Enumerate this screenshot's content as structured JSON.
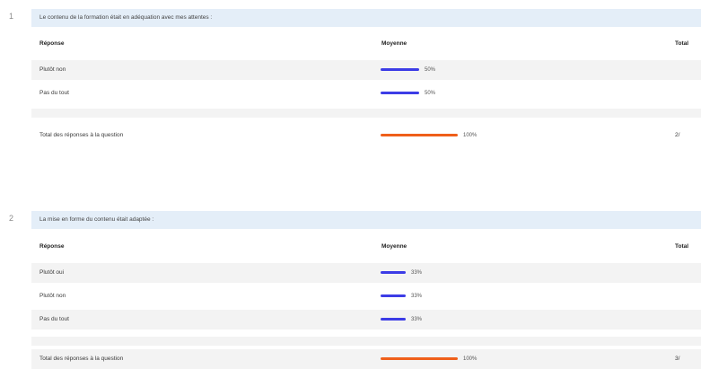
{
  "questions": [
    {
      "number": "1",
      "title": "Le contenu de la formation était en adéquation avec mes attentes :",
      "headers": {
        "response": "Réponse",
        "average": "Moyenne",
        "total": "Total"
      },
      "rows": [
        {
          "label": "Plutôt non",
          "percent": "50%",
          "fraction": 0.5
        },
        {
          "label": "Pas du tout",
          "percent": "50%",
          "fraction": 0.5
        }
      ],
      "total_row": {
        "label": "Total des réponses à la question",
        "percent": "100%",
        "fraction": 1.0,
        "count": "2/"
      },
      "colors": {
        "bar": "#3c3ce6",
        "total_bar": "#ef5f1a"
      }
    },
    {
      "number": "2",
      "title": "La mise en forme du contenu était adaptée :",
      "headers": {
        "response": "Réponse",
        "average": "Moyenne",
        "total": "Total"
      },
      "rows": [
        {
          "label": "Plutôt oui",
          "percent": "33%",
          "fraction": 0.33
        },
        {
          "label": "Plutôt non",
          "percent": "33%",
          "fraction": 0.33
        },
        {
          "label": "Pas du tout",
          "percent": "33%",
          "fraction": 0.33
        }
      ],
      "total_row": {
        "label": "Total des réponses à la question",
        "percent": "100%",
        "fraction": 1.0,
        "count": "3/"
      },
      "colors": {
        "bar": "#3c3ce6",
        "total_bar": "#ef5f1a"
      }
    }
  ]
}
